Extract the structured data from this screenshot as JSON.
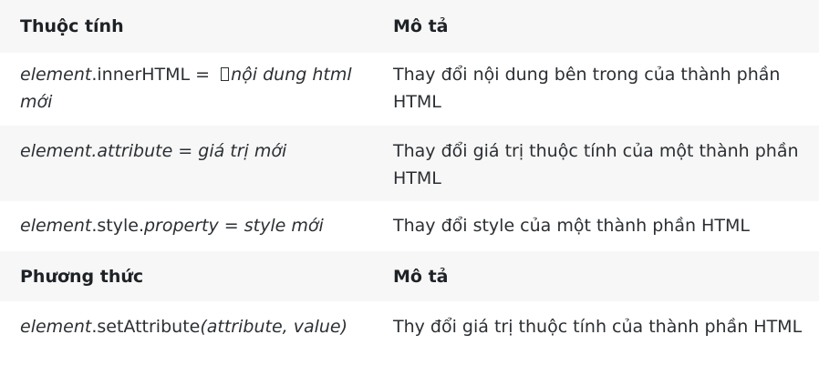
{
  "header": {
    "col1": "Thuộc tính",
    "col2": "Mô tả"
  },
  "rows": [
    {
      "prop": {
        "p1": "element",
        "p2": ".innerHTML = ",
        "p3": "nội dung html",
        "p4": "mới"
      },
      "desc": {
        "l1": "Thay đổi nội dung bên trong của thành phần",
        "l2": "HTML"
      }
    },
    {
      "prop": {
        "p1": "element.attribute = giá trị mới"
      },
      "desc": {
        "l1": "Thay đổi giá trị thuộc tính của một thành phần",
        "l2": "HTML"
      }
    },
    {
      "prop": {
        "p1": "element",
        "p2": ".style.",
        "p3": "property = style mới"
      },
      "desc": {
        "l1": "Thay đổi style của một thành phần HTML"
      }
    }
  ],
  "header2": {
    "col1": "Phương thức",
    "col2": "Mô tả"
  },
  "methods": [
    {
      "prop": {
        "p1": "element",
        "p2": ".setAttribute",
        "p3": "(attribute, value)"
      },
      "desc": {
        "l1": "Thy đổi giá trị thuộc tính của thành phần HTML"
      }
    }
  ],
  "colors": {
    "row_alt_bg": "#f7f7f7",
    "text": "#2b2f33"
  }
}
